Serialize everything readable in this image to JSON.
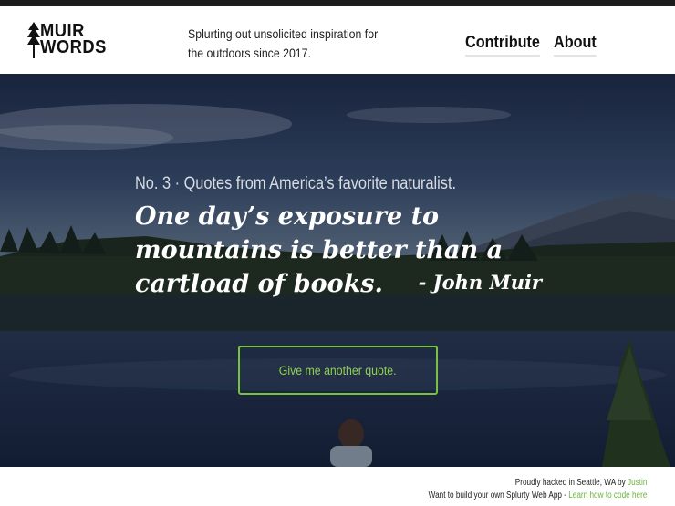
{
  "brand": {
    "logo_line1": "MUIR",
    "logo_line2": "WORDS",
    "tagline": "Splurting out unsolicited inspiration for the outdoors since 2017."
  },
  "nav": {
    "contribute": "Contribute",
    "about": "About"
  },
  "hero": {
    "kicker": "No. 3 · Quotes from America’s favorite naturalist.",
    "quote": "One day’s exposure to mountains is better than a cartload of books.",
    "author": "- John Muir",
    "button_label": "Give me another quote."
  },
  "footer": {
    "credit_text": "Proudly hacked in Seattle, WA by ",
    "credit_link": "Justin",
    "build_text": "Want to build your own Splurty Web App - ",
    "build_link": "Learn how to code here"
  },
  "colors": {
    "accent_green": "#7ac143",
    "dark": "#1c1c1c"
  }
}
